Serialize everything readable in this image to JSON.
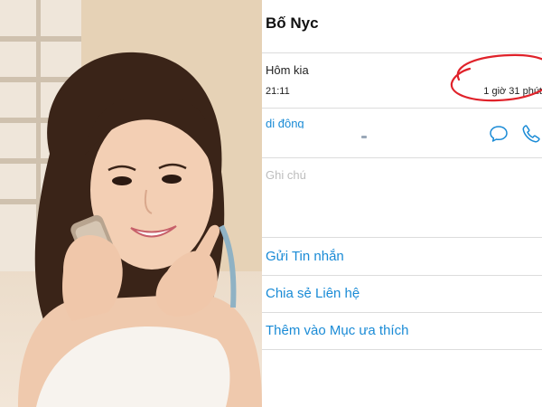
{
  "contact": {
    "name": "Bố Nyc",
    "recent_call": {
      "day": "Hôm kia",
      "time": "21:11",
      "duration": "1 giờ 31 phút"
    },
    "phone": {
      "label": "di động",
      "number": ""
    },
    "notes_label": "Ghi chú",
    "actions": {
      "send_message": "Gửi Tin nhắn",
      "share_contact": "Chia sẻ Liên hệ",
      "add_favorite": "Thêm vào Mục ưa thích"
    }
  },
  "colors": {
    "accent": "#1a8bd6",
    "annotation": "#e0222a",
    "separator": "#dcdcdc",
    "muted": "#bdbdbd"
  },
  "icons": {
    "message": "speech-bubble-icon",
    "call": "phone-handset-icon"
  }
}
